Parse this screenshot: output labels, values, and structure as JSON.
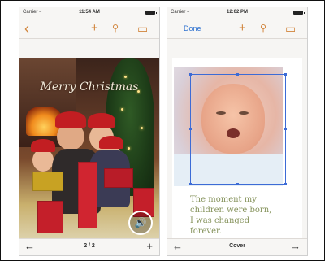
{
  "left_screen": {
    "status": {
      "carrier": "Carrier ≈",
      "time": "11:54 AM"
    },
    "toolbar": {
      "back_icon": "‹",
      "add_icon": "+",
      "tool_icon": "⚲",
      "book_icon": "▭"
    },
    "card": {
      "greeting": "Merry Christmas",
      "sound_icon": "🔊"
    },
    "bottom": {
      "left_arrow": "←",
      "page_indicator": "2 / 2",
      "right_icon": "+"
    }
  },
  "right_screen": {
    "status": {
      "carrier": "Carrier ≈",
      "time": "12:02 PM"
    },
    "toolbar": {
      "done_label": "Done",
      "add_icon": "+",
      "tool_icon": "⚲",
      "book_icon": "▭"
    },
    "page": {
      "caption_line1": "The moment my",
      "caption_line2": "children were born,",
      "caption_line3": "I was changed",
      "caption_line4": "forever."
    },
    "bottom": {
      "left_arrow": "←",
      "page_label": "Cover",
      "right_arrow": "→"
    }
  },
  "colors": {
    "accent_orange": "#d1843b",
    "accent_blue": "#2a6fcf",
    "crop_blue": "#3c6bd6",
    "caption_green": "#86935c"
  }
}
